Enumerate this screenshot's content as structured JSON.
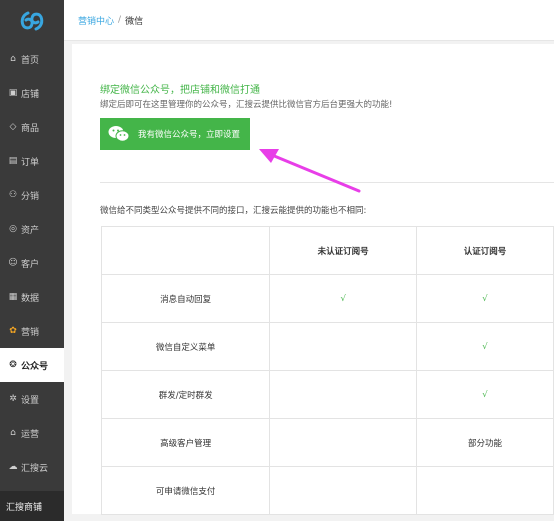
{
  "logo": {
    "icon": "hui-sou-yun-logo",
    "color": "#38a6e0"
  },
  "sidebar": {
    "items": [
      {
        "icon": "home-icon",
        "label": "首页"
      },
      {
        "icon": "store-icon",
        "label": "店铺"
      },
      {
        "icon": "tag-icon",
        "label": "商品"
      },
      {
        "icon": "order-icon",
        "label": "订单"
      },
      {
        "icon": "distribution-icon",
        "label": "分销"
      },
      {
        "icon": "assets-icon",
        "label": "资产"
      },
      {
        "icon": "customer-icon",
        "label": "客户"
      },
      {
        "icon": "data-icon",
        "label": "数据"
      },
      {
        "icon": "marketing-icon",
        "label": "营销"
      },
      {
        "icon": "official-account-icon",
        "label": "公众号",
        "active": true
      },
      {
        "icon": "settings-icon",
        "label": "设置"
      },
      {
        "icon": "operations-icon",
        "label": "运营"
      },
      {
        "icon": "cloud-icon",
        "label": "汇搜云"
      }
    ],
    "bottom_label": "汇搜商铺"
  },
  "breadcrumb": {
    "parent": "营销中心",
    "separator": "/",
    "current": "微信"
  },
  "bind": {
    "title": "绑定微信公众号，把店铺和微信打通",
    "description": "绑定后即可在这里管理你的公众号，汇搜云提供比微信官方后台更强大的功能!",
    "button_label": "我有微信公众号，立即设置"
  },
  "compare": {
    "intro": "微信给不同类型公众号提供不同的接口，汇搜云能提供的功能也不相同:",
    "headers": [
      "",
      "未认证订阅号",
      "认证订阅号"
    ],
    "rows": [
      {
        "feature": "消息自动回复",
        "unverified": "√",
        "verified": "√"
      },
      {
        "feature": "微信自定义菜单",
        "unverified": "",
        "verified": "√"
      },
      {
        "feature": "群发/定时群发",
        "unverified": "",
        "verified": "√"
      },
      {
        "feature": "高级客户管理",
        "unverified": "",
        "verified": "部分功能"
      },
      {
        "feature": "可申请微信支付",
        "unverified": "",
        "verified": ""
      }
    ]
  },
  "colors": {
    "accent_green": "#44b549",
    "link_blue": "#38a6e0",
    "annotation_magenta": "#e83ee8",
    "sidebar_bg": "#3a3a3a"
  }
}
